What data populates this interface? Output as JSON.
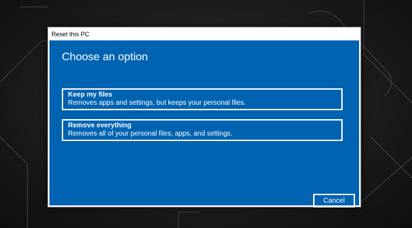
{
  "window": {
    "title": "Reset this PC"
  },
  "main": {
    "heading": "Choose an option",
    "options": [
      {
        "title": "Keep my files",
        "description": "Removes apps and settings, but keeps your personal files."
      },
      {
        "title": "Remove everything",
        "description": "Removes all of your personal files, apps, and settings."
      }
    ],
    "cancel_label": "Cancel"
  },
  "colors": {
    "dialog_background": "#0063b1",
    "text": "#ffffff",
    "desktop": "#1c1c1c"
  }
}
